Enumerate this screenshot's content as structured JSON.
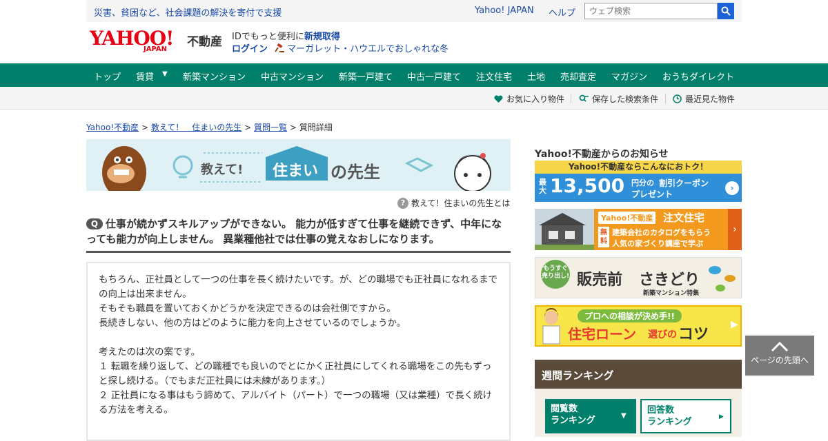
{
  "header": {
    "charity_link": "災害、貧困など、社会課題の解決を寄付で支援",
    "yahoo_japan_link": "Yahoo! JAPAN",
    "help_link": "ヘルプ",
    "search_placeholder": "ウェブ検索",
    "logo_text": "YAHOO!",
    "logo_sub": "JAPAN",
    "site_name": "不動産",
    "id_text": "IDでもっと便利に",
    "id_register": "新規取得",
    "login": "ログイン",
    "promo": "マーガレット・ハウエルでおしゃれな冬"
  },
  "nav": {
    "items": [
      "トップ",
      "賃貸",
      "新築マンション",
      "中古マンション",
      "新築一戸建て",
      "中古一戸建て",
      "注文住宅",
      "土地",
      "売却査定",
      "マガジン",
      "おうちダイレクト"
    ]
  },
  "subnav": {
    "favorites": "お気に入り物件",
    "saved_search": "保存した検索条件",
    "recent": "最近見た物件"
  },
  "breadcrumb": {
    "home": "Yahoo!不動産",
    "section": "教えて！　住まいの先生",
    "list": "質問一覧",
    "current": "質問詳細",
    "separator": ">"
  },
  "banner": {
    "prefix": "教えて!",
    "highlight": "住まい",
    "suffix": "の先生"
  },
  "about_link": "教えて！住まいの先生とは",
  "question": {
    "badge": "Q",
    "title": "仕事が続かずスキルアップができない。 能力が低すぎて仕事を継続できず、中年になっても能力が向上しません。 異業種他社では仕事の覚えなおしになります。",
    "body": [
      "もちろん、正社員として一つの仕事を長く続けたいです。が、どの職場でも正社員になれるまでの向上は出来ません。",
      "そもそも職員を置いておくかどうかを決定できるのは会社側ですから。",
      "長続きしない、他の方はどのように能力を向上させているのでしょうか。",
      "",
      "考えたのは次の案です。",
      "１ 転職を繰り返して、どの職種でも良いのでとにかく正社員にしてくれる職場をこの先もずっと探し続ける。（でもまだ正社員には未練があります。）",
      "２ 正社員になる事はもう諦めて、アルバイト（パート）で一つの職場（又は業種）で長く続ける方法を考える。"
    ]
  },
  "sidebar": {
    "notice_title": "Yahoo!不動産からのお知らせ",
    "ad1_top": "Yahoo!不動産ならこんなにおトク！",
    "ad1_prefix": "最大",
    "ad1_amount": "13,500",
    "ad1_unit": "円分の",
    "ad1_label": "割引クーポン",
    "ad1_suffix": "プレゼント",
    "ad2_brand": "Yahoo!不動産",
    "ad2_title": "注文住宅",
    "ad2_free": "無料",
    "ad2_line1": "建築会社のカタログをもらう",
    "ad2_line2": "人気の家づくり講座で学ぶ",
    "ad3_tag": "もうすぐ売り出し!",
    "ad3_title": "販売前",
    "ad3_title2": "さきどり",
    "ad3_sub": "新築マンション特集",
    "ad4_top": "プロへの相談が決め手!!",
    "ad4_title1": "住宅ローン",
    "ad4_title2": "選びの",
    "ad4_title3": "コツ",
    "weekly_title": "週間ランキング",
    "rank_views_1": "閲覧数",
    "rank_views_2": "ランキング",
    "rank_answers_1": "回答数",
    "rank_answers_2": "ランキング"
  },
  "to_top": "ページの先頭へ",
  "colors": {
    "nav_green": "#00806a",
    "link_blue": "#1a4aa8",
    "logo_red": "#e60012"
  }
}
